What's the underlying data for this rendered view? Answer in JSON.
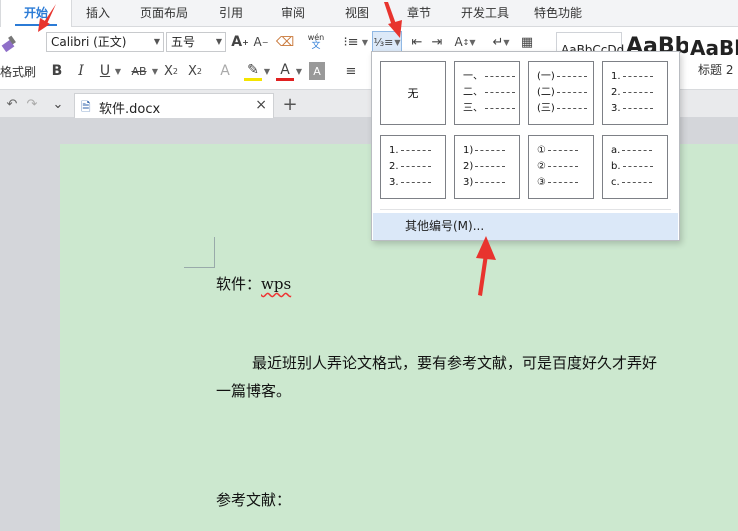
{
  "menu_tabs": [
    "开始",
    "插入",
    "页面布局",
    "引用",
    "审阅",
    "视图",
    "章节",
    "开发工具",
    "特色功能"
  ],
  "ribbon": {
    "format_brush_label": "格式刷",
    "font_name": "Calibri (正文)",
    "font_size": "五号",
    "styles": [
      "AaBbCcDd",
      "AaBb",
      "AaBb"
    ],
    "style_label": "标题 2"
  },
  "document_tab": {
    "filename": "软件.docx"
  },
  "numbering_popup": {
    "none_label": "无",
    "options": [
      {
        "lines": [
          "一、",
          "二、",
          "三、"
        ]
      },
      {
        "lines": [
          "(一)",
          "(二)",
          "(三)"
        ]
      },
      {
        "lines": [
          "1.",
          "2.",
          "3."
        ]
      },
      {
        "lines": [
          "1.",
          "2.",
          "3."
        ]
      },
      {
        "lines": [
          "1)",
          "2)",
          "3)"
        ]
      },
      {
        "lines": [
          "①",
          "②",
          "③"
        ]
      },
      {
        "lines": [
          "a.",
          "b.",
          "c."
        ]
      }
    ],
    "more_label": "其他编号(M)..."
  },
  "document": {
    "line1_prefix": "软件：",
    "line1_word": "wps",
    "paragraph1": "最近班别人弄论文格式，要有参考文献，可是百度好久才弄好",
    "paragraph2": "一篇博客。",
    "references": "参考文献："
  },
  "colors": {
    "accent": "#2b7bd6",
    "page": "#cce8cf",
    "arrow": "#e8342e"
  }
}
